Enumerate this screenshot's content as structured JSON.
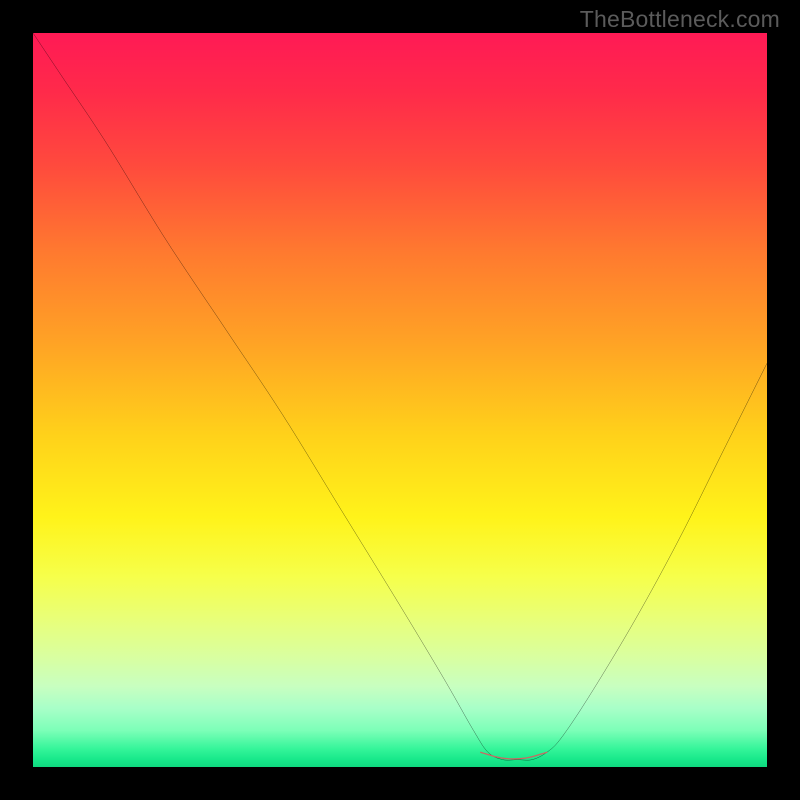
{
  "attribution": "TheBottleneck.com",
  "chart_data": {
    "type": "line",
    "title": "",
    "xlabel": "",
    "ylabel": "",
    "xlim": [
      0,
      100
    ],
    "ylim": [
      0,
      100
    ],
    "grid": false,
    "series": [
      {
        "name": "bottleneck-curve",
        "x": [
          0,
          4,
          10,
          18,
          26,
          34,
          42,
          50,
          56,
          60,
          62,
          64,
          66,
          68,
          70,
          72,
          76,
          82,
          88,
          94,
          100
        ],
        "y": [
          100,
          94,
          85,
          72,
          60,
          48,
          35,
          22,
          12,
          5,
          2,
          1,
          1,
          1,
          2,
          4,
          10,
          20,
          31,
          43,
          55
        ]
      },
      {
        "name": "optimal-range-marker",
        "x": [
          61,
          64,
          67,
          70
        ],
        "y": [
          2,
          1.2,
          1.2,
          2
        ]
      }
    ],
    "background_gradient": {
      "orientation": "vertical",
      "stops": [
        {
          "pos": 0.0,
          "color": "#ff1a55"
        },
        {
          "pos": 0.3,
          "color": "#ff7a2f"
        },
        {
          "pos": 0.55,
          "color": "#ffd21a"
        },
        {
          "pos": 0.75,
          "color": "#f6ff4a"
        },
        {
          "pos": 0.92,
          "color": "#a8ffc8"
        },
        {
          "pos": 1.0,
          "color": "#0fd97f"
        }
      ]
    },
    "optimal_range_color": "#c86a63"
  }
}
